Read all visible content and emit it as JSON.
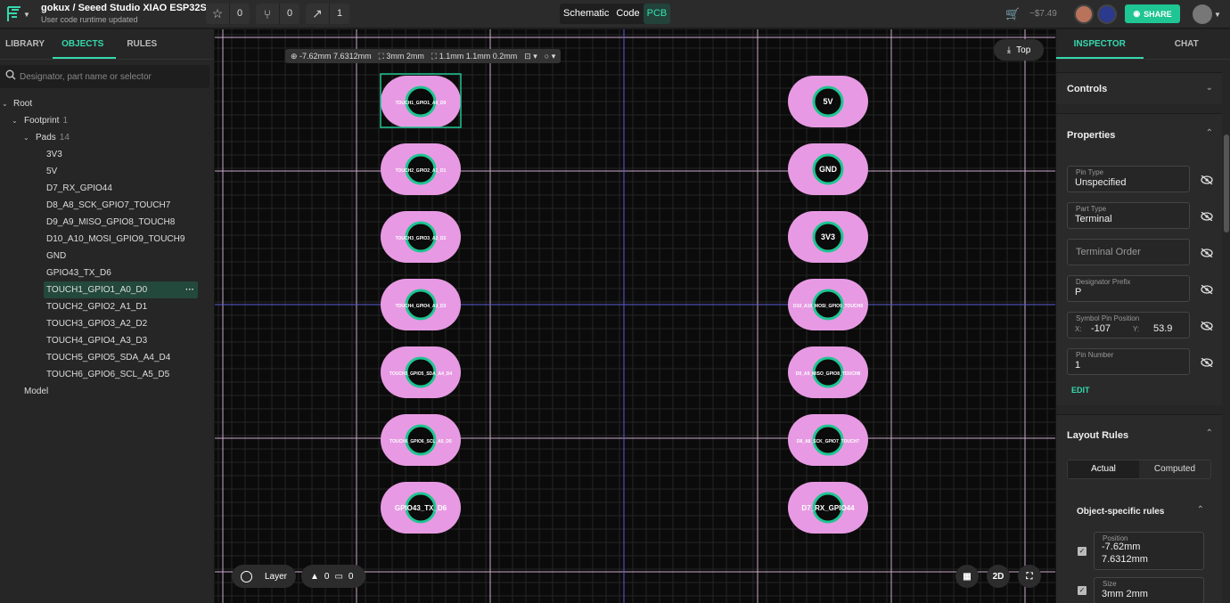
{
  "header": {
    "owner": "gokux",
    "separator": " / ",
    "project": "Seeed Studio XIAO ESP32S3",
    "subtitle": "User code runtime updated",
    "star_count": "0",
    "fork_count": "0",
    "trend_count": "1",
    "views": [
      "Schematic",
      "Code",
      "PCB"
    ],
    "price": "~$7.49",
    "share_label": "SHARE",
    "accent": "#1fc592"
  },
  "left": {
    "tabs": [
      "LIBRARY",
      "OBJECTS",
      "RULES"
    ],
    "search_placeholder": "Designator, part name or selector",
    "tree": {
      "root": "Root",
      "footprint": "Footprint",
      "footprint_count": "1",
      "pads": "Pads",
      "pads_count": "14",
      "pad_items": [
        "3V3",
        "5V",
        "D7_RX_GPIO44",
        "D8_A8_SCK_GPIO7_TOUCH7",
        "D9_A9_MISO_GPIO8_TOUCH8",
        "D10_A10_MOSI_GPIO9_TOUCH9",
        "GND",
        "GPIO43_TX_D6",
        "TOUCH1_GPIO1_A0_D0",
        "TOUCH2_GPIO2_A1_D1",
        "TOUCH3_GPIO3_A2_D2",
        "TOUCH4_GPIO4_A3_D3",
        "TOUCH5_GPIO5_SDA_A4_D4",
        "TOUCH6_GPIO6_SCL_A5_D5"
      ],
      "selected_index": 8,
      "more": "···",
      "model": "Model"
    }
  },
  "canvas": {
    "coord_position": "-7.62mm 7.6312mm",
    "coord_size": "3mm 2mm",
    "coord_hole": "1.1mm 1.1mm 0.2mm",
    "top_label": "Top",
    "layer_label": "Layer",
    "warn_count": "0",
    "comment_count": "0",
    "view_2d": "2D",
    "pads_left": [
      "TOUCH1_GPIO1_A0_D0",
      "TOUCH2_GPIO2_A1_D1",
      "TOUCH3_GPIO3_A2_D2",
      "TOUCH4_GPIO4_A3_D3",
      "TOUCH5_GPIO5_SDA_A4_D4",
      "TOUCH6_GPIO6_SCL_A5_D5",
      "GPIO43_TX_D6"
    ],
    "pads_right": [
      "5V",
      "GND",
      "3V3",
      "D10_A10_MOSI_GPIO9_TOUCH9",
      "D9_A9_MISO_GPIO8_TOUCH8",
      "D8_A8_SCK_GPIO7_TOUCH7",
      "D7_RX_GPIO44"
    ],
    "pad_color": "#e79ae3",
    "ring_color": "#1fc592"
  },
  "inspector": {
    "tabs": [
      "INSPECTOR",
      "CHAT"
    ],
    "controls": "Controls",
    "properties": "Properties",
    "pin_type_label": "Pin Type",
    "pin_type": "Unspecified",
    "part_type_label": "Part Type",
    "part_type": "Terminal",
    "terminal_order_placeholder": "Terminal Order",
    "designator_prefix_label": "Designator Prefix",
    "designator_prefix": "P",
    "symbol_pin_label": "Symbol Pin Position",
    "x_label": "X:",
    "x_value": "-107",
    "y_label": "Y:",
    "y_value": "53.9",
    "pin_number_label": "Pin Number",
    "pin_number": "1",
    "edit": "EDIT",
    "layout_rules": "Layout Rules",
    "rule_tabs": [
      "Actual",
      "Computed"
    ],
    "object_rules": "Object-specific rules",
    "position_label": "Position",
    "position_line1": "-7.62mm",
    "position_line2": "7.6312mm",
    "size_label": "Size",
    "size_value": "3mm 2mm"
  }
}
